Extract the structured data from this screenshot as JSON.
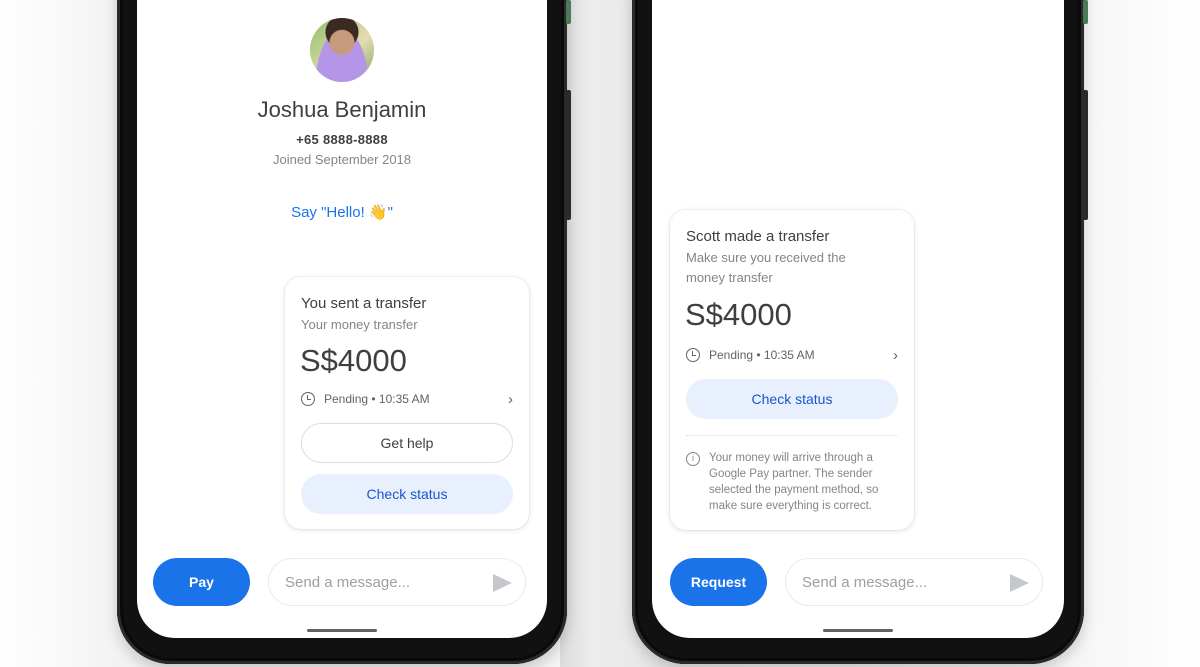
{
  "left_phone": {
    "profile": {
      "name": "Joshua Benjamin",
      "phone": "+65 8888-8888",
      "joined": "Joined September 2018",
      "say_hello": "Say \"Hello! 👋\""
    },
    "transfer_card": {
      "title": "You sent a transfer",
      "subtitle": "Your money transfer",
      "amount": "S$4000",
      "status": "Pending • 10:35 AM",
      "get_help_label": "Get help",
      "check_status_label": "Check status"
    },
    "bottom_bar": {
      "primary_button_label": "Pay",
      "message_placeholder": "Send a message..."
    }
  },
  "right_phone": {
    "transfer_card": {
      "title": "Scott made a transfer",
      "subtitle": "Make sure you received the money transfer",
      "amount": "S$4000",
      "status": "Pending • 10:35 AM",
      "check_status_label": "Check status",
      "info_text": "Your money will arrive through a Google Pay partner. The sender selected the payment method, so make sure everything is correct."
    },
    "bottom_bar": {
      "primary_button_label": "Request",
      "message_placeholder": "Send a message..."
    }
  },
  "colors": {
    "accent": "#1a73e8",
    "tonal_button_bg": "#e8f0fe",
    "text_primary": "#3c4043",
    "text_secondary": "#80868b"
  },
  "icons": {
    "clock": "clock-icon",
    "chevron": "chevron-right-icon",
    "send": "send-icon",
    "info": "info-icon"
  }
}
